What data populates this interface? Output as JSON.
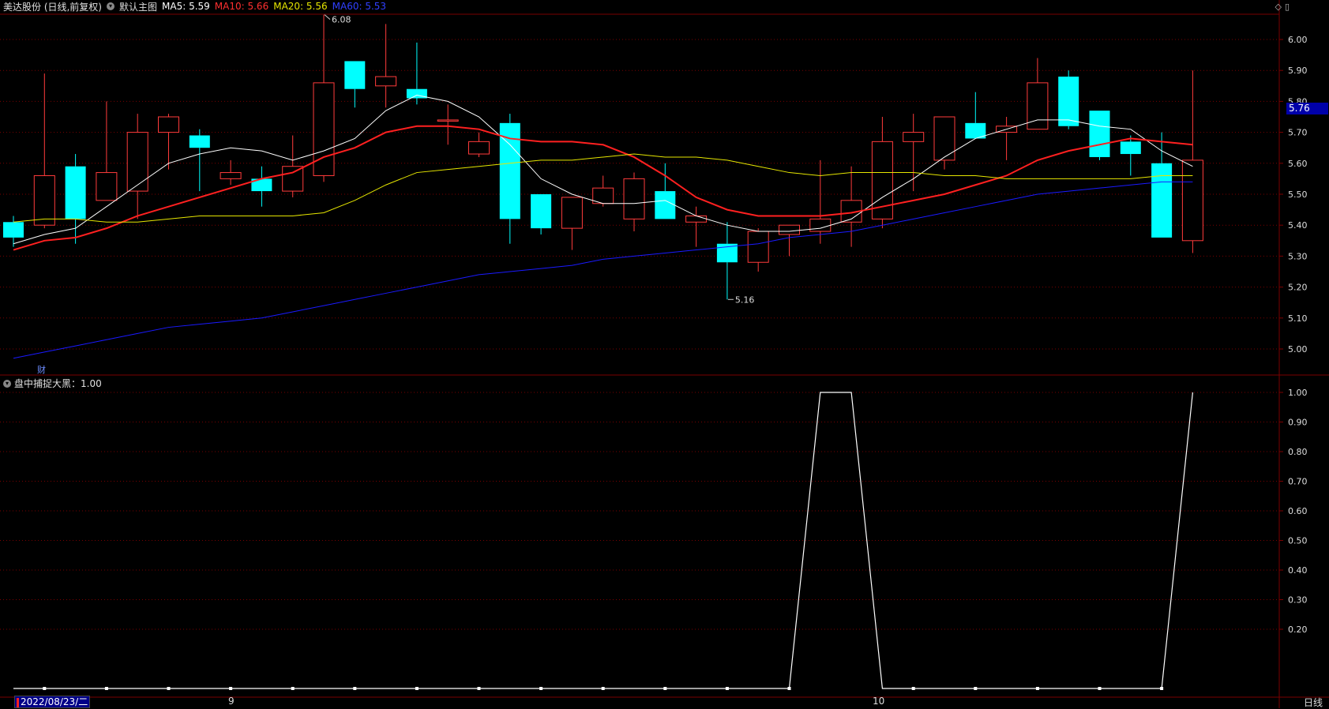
{
  "header": {
    "stock": "美达股份 (日线,前复权)",
    "main_chart": "默认主图",
    "ma5": "MA5: 5.59",
    "ma10": "MA10: 5.66",
    "ma20": "MA20: 5.56",
    "ma60": "MA60: 5.53",
    "icons": [
      "diamond-icon",
      "window-icon"
    ]
  },
  "indicator_header": "盘中捕捉大黑：1.00",
  "current_price_tag": "5.76",
  "cai_mark": "财",
  "x_axis": {
    "start_date": "2022/08/23/二",
    "month_marks": [
      "9",
      "10"
    ],
    "period": "日线"
  },
  "colors": {
    "up": "#ff3b3b",
    "down": "#00ffff",
    "ma5": "#ffffff",
    "ma10": "#ff2020",
    "ma20": "#e6e600",
    "ma60": "#1a1aff",
    "grid": "#7a0000",
    "axis_text": "#dddddd"
  },
  "chart_data": [
    {
      "type": "candlestick",
      "ylim": [
        4.93,
        6.08
      ],
      "y_ticks": [
        "6.00",
        "5.90",
        "5.80",
        "5.70",
        "5.60",
        "5.50",
        "5.40",
        "5.30",
        "5.20",
        "5.10",
        "5.00"
      ],
      "annotations": [
        {
          "label": "6.08",
          "value": 6.08
        },
        {
          "label": "5.16",
          "value": 5.16
        }
      ],
      "candles": [
        {
          "o": 5.41,
          "h": 5.43,
          "l": 5.33,
          "c": 5.36
        },
        {
          "o": 5.4,
          "h": 5.89,
          "l": 5.39,
          "c": 5.56
        },
        {
          "o": 5.59,
          "h": 5.63,
          "l": 5.34,
          "c": 5.42
        },
        {
          "o": 5.48,
          "h": 5.8,
          "l": 5.48,
          "c": 5.57
        },
        {
          "o": 5.51,
          "h": 5.76,
          "l": 5.42,
          "c": 5.7
        },
        {
          "o": 5.7,
          "h": 5.76,
          "l": 5.58,
          "c": 5.75
        },
        {
          "o": 5.69,
          "h": 5.71,
          "l": 5.51,
          "c": 5.65
        },
        {
          "o": 5.55,
          "h": 5.61,
          "l": 5.53,
          "c": 5.57
        },
        {
          "o": 5.55,
          "h": 5.59,
          "l": 5.46,
          "c": 5.51
        },
        {
          "o": 5.51,
          "h": 5.69,
          "l": 5.49,
          "c": 5.59
        },
        {
          "o": 5.56,
          "h": 6.08,
          "l": 5.54,
          "c": 5.86
        },
        {
          "o": 5.93,
          "h": 5.93,
          "l": 5.78,
          "c": 5.84
        },
        {
          "o": 5.85,
          "h": 6.05,
          "l": 5.78,
          "c": 5.88
        },
        {
          "o": 5.84,
          "h": 5.99,
          "l": 5.79,
          "c": 5.81
        },
        {
          "o": 5.74,
          "h": 5.79,
          "l": 5.66,
          "c": 5.74
        },
        {
          "o": 5.63,
          "h": 5.7,
          "l": 5.62,
          "c": 5.67
        },
        {
          "o": 5.73,
          "h": 5.76,
          "l": 5.34,
          "c": 5.42
        },
        {
          "o": 5.5,
          "h": 5.5,
          "l": 5.37,
          "c": 5.39
        },
        {
          "o": 5.39,
          "h": 5.49,
          "l": 5.32,
          "c": 5.49
        },
        {
          "o": 5.47,
          "h": 5.56,
          "l": 5.46,
          "c": 5.52
        },
        {
          "o": 5.42,
          "h": 5.57,
          "l": 5.38,
          "c": 5.55
        },
        {
          "o": 5.51,
          "h": 5.6,
          "l": 5.42,
          "c": 5.42
        },
        {
          "o": 5.41,
          "h": 5.46,
          "l": 5.33,
          "c": 5.43
        },
        {
          "o": 5.34,
          "h": 5.41,
          "l": 5.16,
          "c": 5.28
        },
        {
          "o": 5.28,
          "h": 5.39,
          "l": 5.25,
          "c": 5.38
        },
        {
          "o": 5.37,
          "h": 5.4,
          "l": 5.3,
          "c": 5.4
        },
        {
          "o": 5.38,
          "h": 5.61,
          "l": 5.34,
          "c": 5.42
        },
        {
          "o": 5.41,
          "h": 5.59,
          "l": 5.33,
          "c": 5.48
        },
        {
          "o": 5.42,
          "h": 5.75,
          "l": 5.39,
          "c": 5.67
        },
        {
          "o": 5.67,
          "h": 5.76,
          "l": 5.51,
          "c": 5.7
        },
        {
          "o": 5.61,
          "h": 5.75,
          "l": 5.58,
          "c": 5.75
        },
        {
          "o": 5.73,
          "h": 5.83,
          "l": 5.68,
          "c": 5.68
        },
        {
          "o": 5.7,
          "h": 5.75,
          "l": 5.61,
          "c": 5.72
        },
        {
          "o": 5.71,
          "h": 5.94,
          "l": 5.71,
          "c": 5.86
        },
        {
          "o": 5.88,
          "h": 5.9,
          "l": 5.71,
          "c": 5.72
        },
        {
          "o": 5.77,
          "h": 5.77,
          "l": 5.61,
          "c": 5.62
        },
        {
          "o": 5.67,
          "h": 5.69,
          "l": 5.56,
          "c": 5.63
        },
        {
          "o": 5.6,
          "h": 5.7,
          "l": 5.36,
          "c": 5.36
        },
        {
          "o": 5.35,
          "h": 5.9,
          "l": 5.31,
          "c": 5.61
        }
      ],
      "series": [
        {
          "name": "MA5",
          "values": [
            5.34,
            5.37,
            5.39,
            5.46,
            5.53,
            5.6,
            5.63,
            5.65,
            5.64,
            5.61,
            5.64,
            5.68,
            5.77,
            5.82,
            5.8,
            5.75,
            5.66,
            5.55,
            5.5,
            5.47,
            5.47,
            5.48,
            5.43,
            5.4,
            5.38,
            5.38,
            5.39,
            5.42,
            5.49,
            5.55,
            5.62,
            5.68,
            5.71,
            5.74,
            5.74,
            5.72,
            5.71,
            5.64,
            5.59
          ]
        },
        {
          "name": "MA10",
          "values": [
            5.32,
            5.35,
            5.36,
            5.39,
            5.43,
            5.46,
            5.49,
            5.52,
            5.55,
            5.57,
            5.62,
            5.65,
            5.7,
            5.72,
            5.72,
            5.71,
            5.68,
            5.67,
            5.67,
            5.66,
            5.62,
            5.56,
            5.49,
            5.45,
            5.43,
            5.43,
            5.43,
            5.44,
            5.46,
            5.48,
            5.5,
            5.53,
            5.56,
            5.61,
            5.64,
            5.66,
            5.68,
            5.67,
            5.66
          ]
        },
        {
          "name": "MA20",
          "values": [
            5.41,
            5.42,
            5.42,
            5.41,
            5.41,
            5.42,
            5.43,
            5.43,
            5.43,
            5.43,
            5.44,
            5.48,
            5.53,
            5.57,
            5.58,
            5.59,
            5.6,
            5.61,
            5.61,
            5.62,
            5.63,
            5.62,
            5.62,
            5.61,
            5.59,
            5.57,
            5.56,
            5.57,
            5.57,
            5.57,
            5.56,
            5.56,
            5.55,
            5.55,
            5.55,
            5.55,
            5.55,
            5.56,
            5.56
          ]
        },
        {
          "name": "MA60",
          "values": [
            4.97,
            4.99,
            5.01,
            5.03,
            5.05,
            5.07,
            5.08,
            5.09,
            5.1,
            5.12,
            5.14,
            5.16,
            5.18,
            5.2,
            5.22,
            5.24,
            5.25,
            5.26,
            5.27,
            5.29,
            5.3,
            5.31,
            5.32,
            5.33,
            5.34,
            5.36,
            5.37,
            5.38,
            5.4,
            5.42,
            5.44,
            5.46,
            5.48,
            5.5,
            5.51,
            5.52,
            5.53,
            5.54,
            5.54
          ]
        }
      ]
    },
    {
      "type": "line",
      "title": "盘中捕捉大黑",
      "ylim": [
        0,
        1.05
      ],
      "y_ticks": [
        "1.00",
        "0.90",
        "0.80",
        "0.70",
        "0.60",
        "0.50",
        "0.40",
        "0.30",
        "0.20"
      ],
      "series": [
        {
          "name": "盘中捕捉大黑",
          "values": [
            0,
            0,
            0,
            0,
            0,
            0,
            0,
            0,
            0,
            0,
            0,
            0,
            0,
            0,
            0,
            0,
            0,
            0,
            0,
            0,
            0,
            0,
            0,
            0,
            0,
            0,
            1,
            1,
            0,
            0,
            0,
            0,
            0,
            0,
            0,
            0,
            0,
            0,
            1
          ]
        }
      ]
    }
  ]
}
